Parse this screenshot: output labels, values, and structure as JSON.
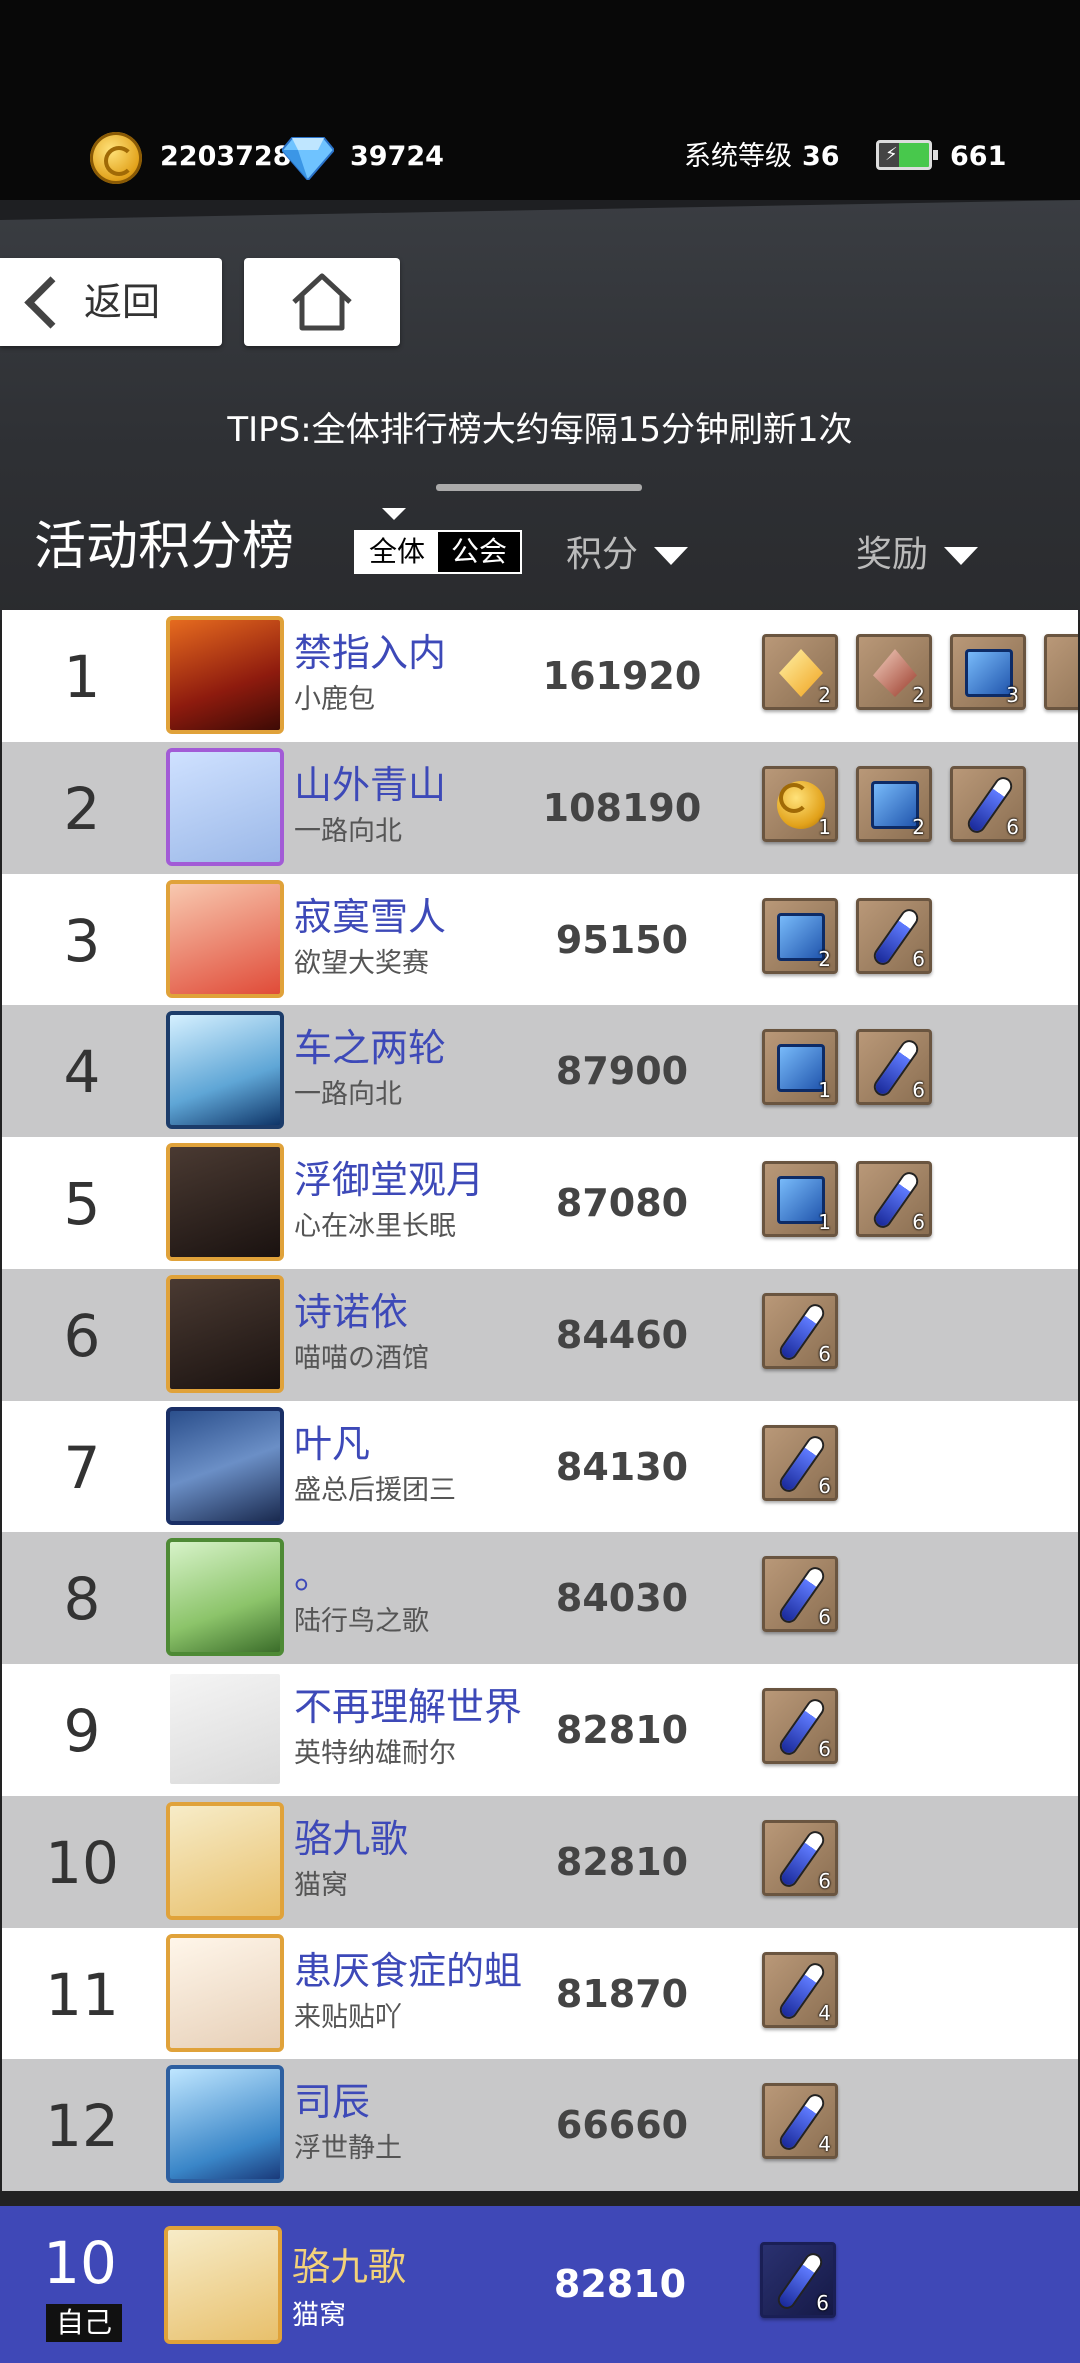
{
  "status": {
    "gold": "2203728",
    "diamonds": "39724",
    "level_label": "系统等级",
    "level": "36",
    "stamina": "661"
  },
  "nav": {
    "back_label": "返回"
  },
  "tips": "TIPS:全体排行榜大约每隔15分钟刷新1次",
  "board": {
    "title": "活动积分榜",
    "tab_all": "全体",
    "tab_guild": "公会",
    "col_score": "积分",
    "col_reward": "奖励"
  },
  "rows": [
    {
      "rank": "1",
      "name": "禁指入内",
      "guild": "小鹿包",
      "score": "161920",
      "rewards": [
        {
          "type": "gold",
          "count": "2"
        },
        {
          "type": "red",
          "count": "2"
        },
        {
          "type": "book",
          "count": "3"
        }
      ]
    },
    {
      "rank": "2",
      "name": "山外青山",
      "guild": "一路向北",
      "score": "108190",
      "rewards": [
        {
          "type": "coin",
          "count": "1"
        },
        {
          "type": "book",
          "count": "2"
        },
        {
          "type": "vial",
          "count": "6"
        }
      ]
    },
    {
      "rank": "3",
      "name": "寂寞雪人",
      "guild": "欲望大奖赛",
      "score": "95150",
      "rewards": [
        {
          "type": "book",
          "count": "2"
        },
        {
          "type": "vial",
          "count": "6"
        }
      ]
    },
    {
      "rank": "4",
      "name": "车之两轮",
      "guild": "一路向北",
      "score": "87900",
      "rewards": [
        {
          "type": "book",
          "count": "1"
        },
        {
          "type": "vial",
          "count": "6"
        }
      ]
    },
    {
      "rank": "5",
      "name": "浮御堂观月",
      "guild": "心在冰里长眠",
      "score": "87080",
      "rewards": [
        {
          "type": "book",
          "count": "1"
        },
        {
          "type": "vial",
          "count": "6"
        }
      ]
    },
    {
      "rank": "6",
      "name": "诗诺依",
      "guild": "喵喵の酒馆",
      "score": "84460",
      "rewards": [
        {
          "type": "vial",
          "count": "6"
        }
      ]
    },
    {
      "rank": "7",
      "name": "叶凡",
      "guild": "盛总后援团三",
      "score": "84130",
      "rewards": [
        {
          "type": "vial",
          "count": "6"
        }
      ]
    },
    {
      "rank": "8",
      "name": "。",
      "guild": "陆行鸟之歌",
      "score": "84030",
      "rewards": [
        {
          "type": "vial",
          "count": "6"
        }
      ]
    },
    {
      "rank": "9",
      "name": "不再理解世界",
      "guild": "英特纳雄耐尔",
      "score": "82810",
      "rewards": [
        {
          "type": "vial",
          "count": "6"
        }
      ]
    },
    {
      "rank": "10",
      "name": "骆九歌",
      "guild": "猫窝",
      "score": "82810",
      "rewards": [
        {
          "type": "vial",
          "count": "6"
        }
      ]
    },
    {
      "rank": "11",
      "name": "患厌食症的蛆",
      "guild": "来贴贴吖",
      "score": "81870",
      "rewards": [
        {
          "type": "vial",
          "count": "4"
        }
      ]
    },
    {
      "rank": "12",
      "name": "司辰",
      "guild": "浮世静土",
      "score": "66660",
      "rewards": [
        {
          "type": "vial",
          "count": "4"
        }
      ]
    }
  ],
  "self": {
    "rank": "10",
    "tag": "自己",
    "name": "骆九歌",
    "guild": "猫窝",
    "score": "82810",
    "rewards": [
      {
        "type": "vial",
        "count": "6"
      }
    ]
  }
}
